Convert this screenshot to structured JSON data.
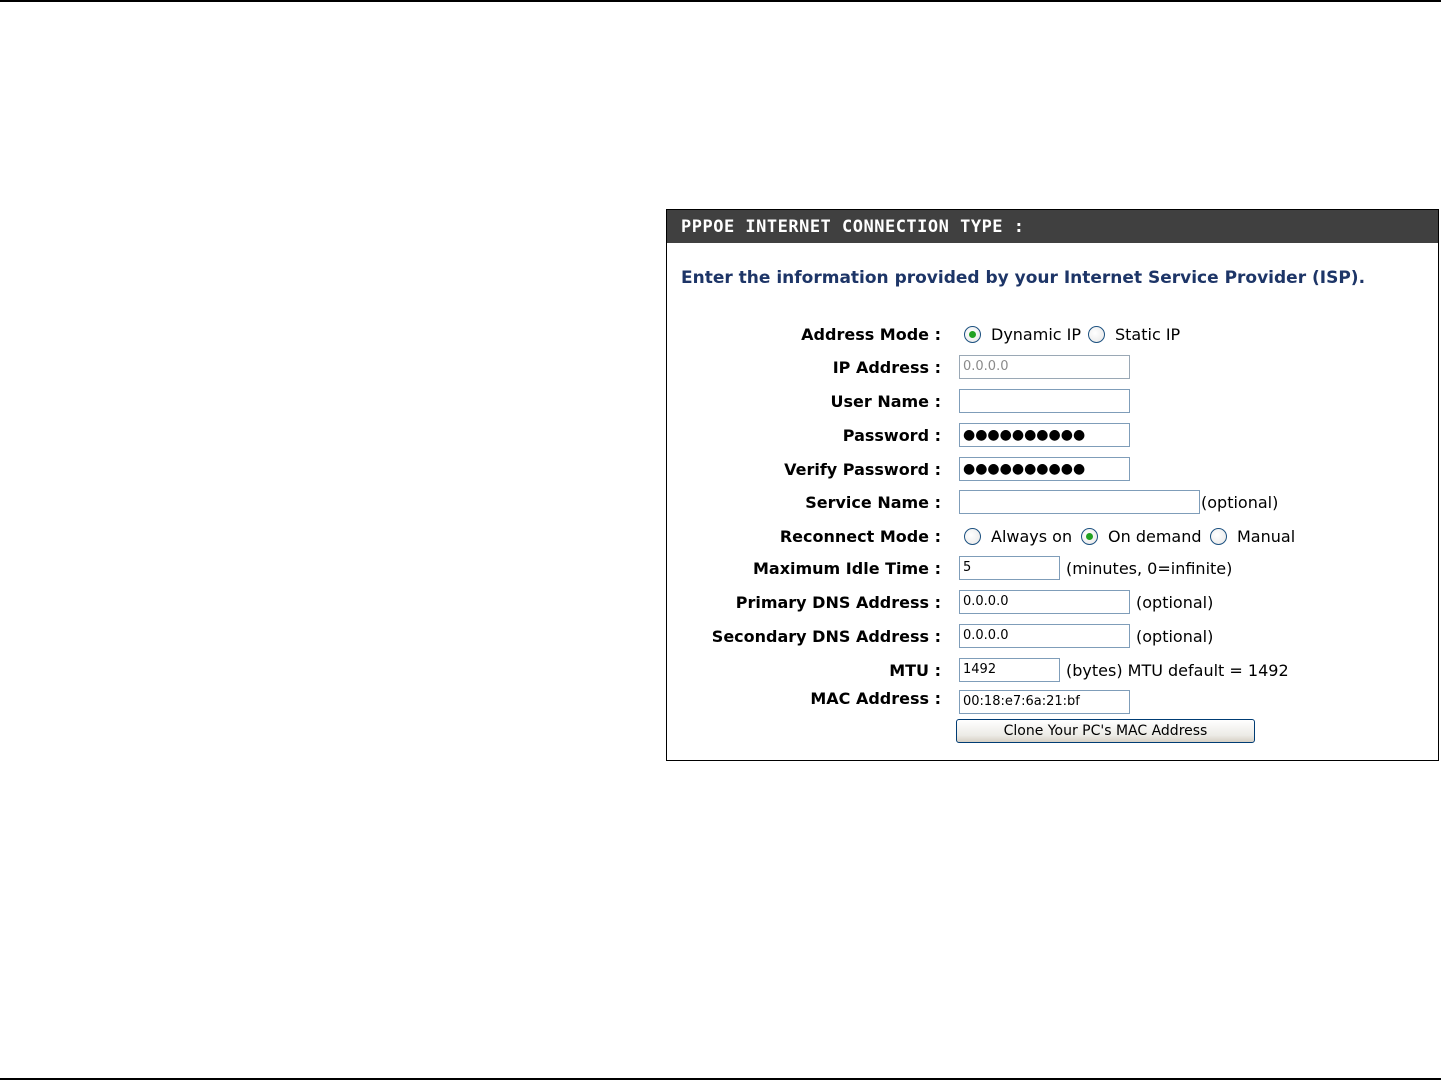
{
  "header": {
    "title": "PPPOE INTERNET CONNECTION TYPE :"
  },
  "intro": "Enter the information provided by your Internet Service Provider (ISP).",
  "address_mode": {
    "label": "Address Mode :",
    "options": [
      {
        "label": "Dynamic IP",
        "checked": true
      },
      {
        "label": "Static IP",
        "checked": false
      }
    ]
  },
  "ip_address": {
    "label": "IP Address :",
    "value": "0.0.0.0"
  },
  "user_name": {
    "label": "User Name :",
    "value": ""
  },
  "password": {
    "label": "Password :",
    "value": "●●●●●●●●●●"
  },
  "verify_password": {
    "label": "Verify Password :",
    "value": "●●●●●●●●●●"
  },
  "service_name": {
    "label": "Service Name :",
    "value": "",
    "note": "(optional)"
  },
  "reconnect_mode": {
    "label": "Reconnect Mode :",
    "options": [
      {
        "label": "Always on",
        "checked": false
      },
      {
        "label": "On demand",
        "checked": true
      },
      {
        "label": "Manual",
        "checked": false
      }
    ]
  },
  "max_idle_time": {
    "label": "Maximum Idle Time :",
    "value": "5",
    "note": "(minutes, 0=infinite)"
  },
  "primary_dns": {
    "label": "Primary DNS Address :",
    "value": "0.0.0.0",
    "note": "(optional)"
  },
  "secondary_dns": {
    "label": "Secondary DNS Address :",
    "value": "0.0.0.0",
    "note": "(optional)"
  },
  "mtu": {
    "label": "MTU :",
    "value": "1492",
    "note": "(bytes) MTU default = 1492"
  },
  "mac_address": {
    "label": "MAC Address :",
    "value": "00:18:e7:6a:21:bf"
  },
  "clone_button": {
    "label": "Clone Your PC's MAC Address"
  }
}
